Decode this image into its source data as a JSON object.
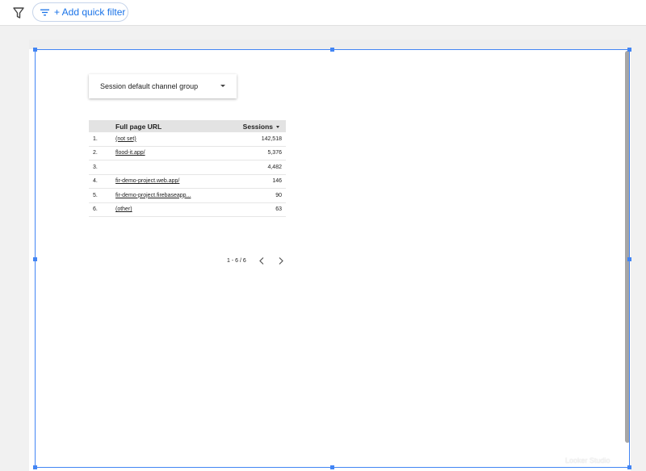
{
  "toolbar": {
    "filter_icon": "filter-icon",
    "quick_filter_label": "+ Add quick filter",
    "accent_color": "#1a73e8"
  },
  "control": {
    "dropdown_label": "Session default channel group"
  },
  "table": {
    "headers": {
      "url": "Full page URL",
      "sessions": "Sessions"
    },
    "rows": [
      {
        "index": "1.",
        "url": "(not set)",
        "sessions": "142,518"
      },
      {
        "index": "2.",
        "url": "flood-it.app/",
        "sessions": "5,376"
      },
      {
        "index": "3.",
        "url": "",
        "sessions": "4,482"
      },
      {
        "index": "4.",
        "url": "fir-demo-project.web.app/",
        "sessions": "146"
      },
      {
        "index": "5.",
        "url": "fir-demo-project.firebaseapp...",
        "sessions": "90"
      },
      {
        "index": "6.",
        "url": "(other)",
        "sessions": "63"
      }
    ],
    "pagination": "1 - 6 / 6"
  },
  "watermark": "Looker Studio",
  "selection_color": "#4285f4"
}
